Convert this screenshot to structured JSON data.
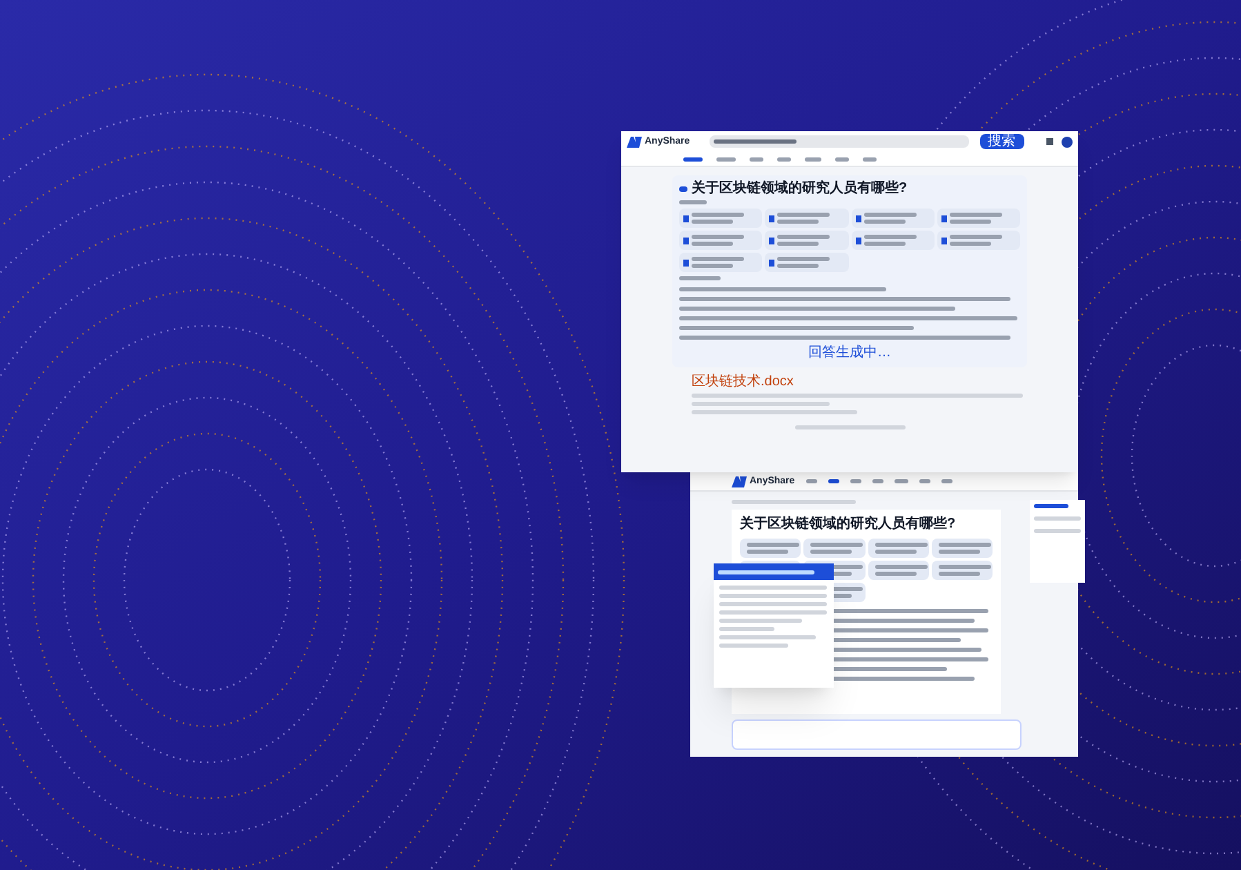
{
  "screens": [
    {
      "brand": "AnyShare",
      "search_button": "搜索",
      "question": "关于区块链领域的研究人员有哪些?",
      "status": "回答生成中…",
      "result": {
        "title": "区块链技术.docx"
      }
    },
    {
      "brand": "AnyShare",
      "question": "关于区块链领域的研究人员有哪些?"
    }
  ]
}
